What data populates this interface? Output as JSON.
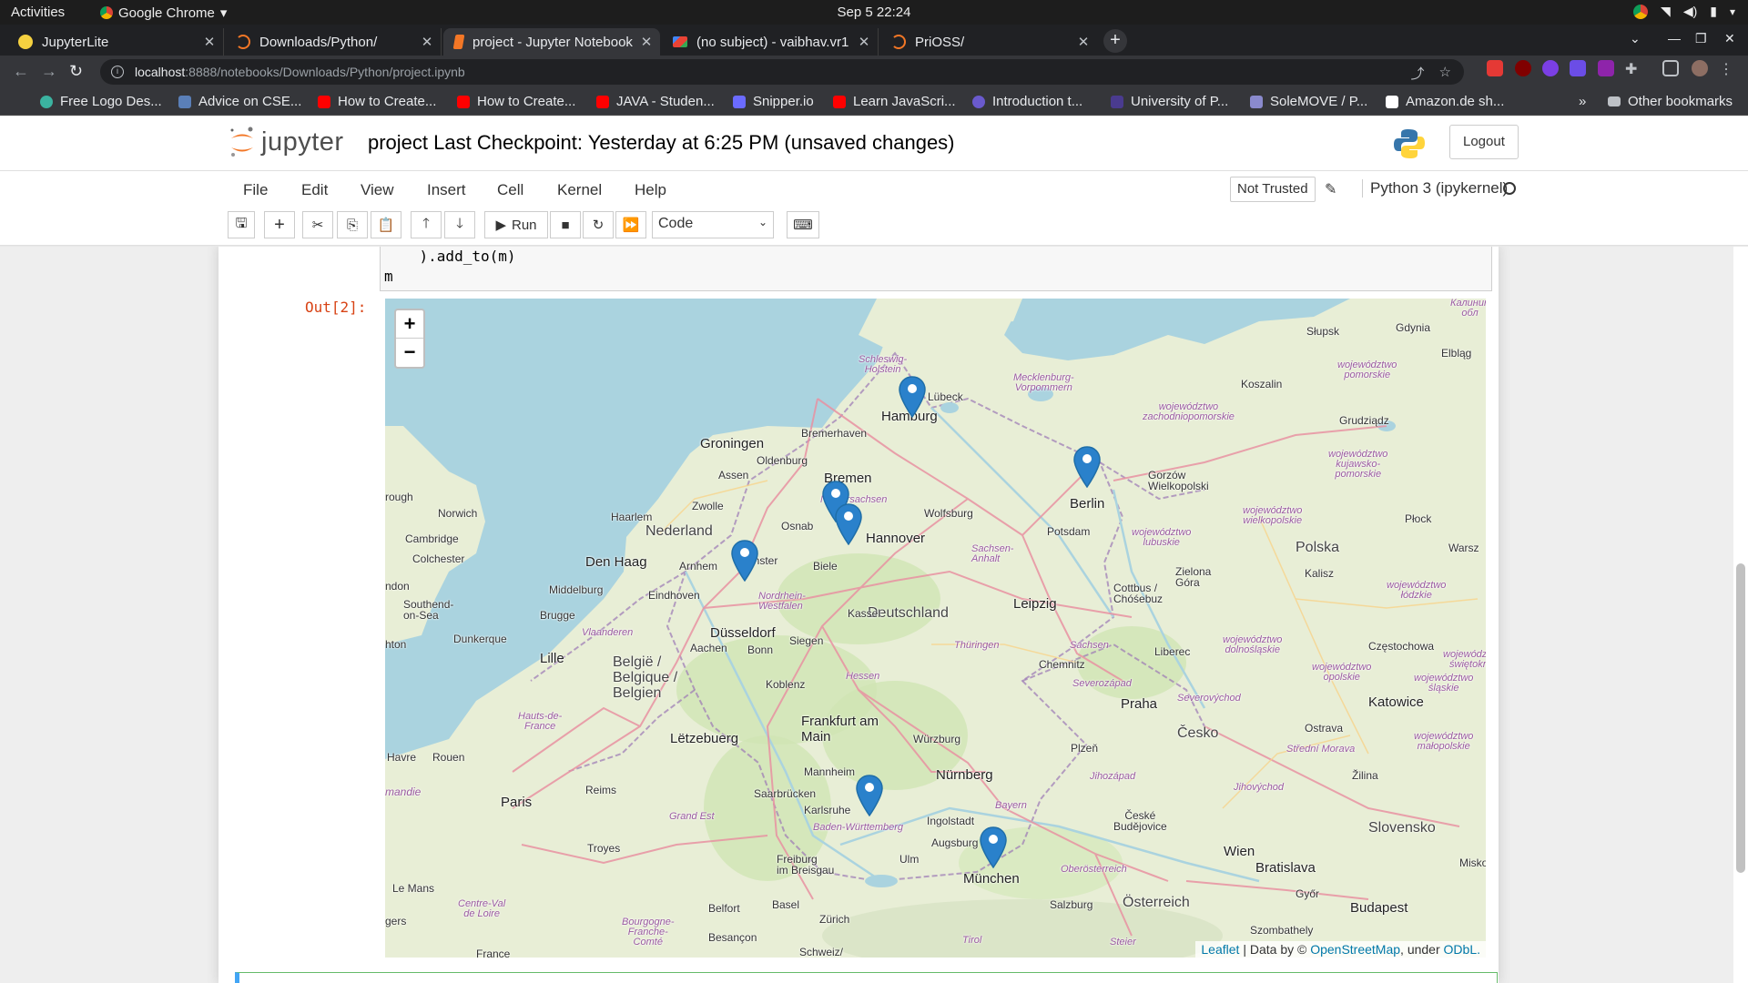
{
  "os": {
    "activities": "Activities",
    "app_name": "Google Chrome",
    "clock": "Sep 5  22:24"
  },
  "tabs": [
    {
      "title": "JupyterLite",
      "active": false
    },
    {
      "title": "Downloads/Python/",
      "active": false
    },
    {
      "title": "project - Jupyter Notebook",
      "active": true
    },
    {
      "title": "(no subject) - vaibhav.vr1",
      "active": false
    },
    {
      "title": "PriOSS/",
      "active": false
    }
  ],
  "address": {
    "host": "localhost",
    "path": ":8888/notebooks/Downloads/Python/project.ipynb"
  },
  "bookmarks": [
    {
      "label": "Free Logo Des...",
      "color": "#3bb3a0"
    },
    {
      "label": "Advice on CSE...",
      "color": "#5a7fb8"
    },
    {
      "label": "How to Create...",
      "color": "#ff0000"
    },
    {
      "label": "How to Create...",
      "color": "#ff0000"
    },
    {
      "label": "JAVA - Studen...",
      "color": "#ff0000"
    },
    {
      "label": "Snipper.io",
      "color": "#6b6bff"
    },
    {
      "label": "Learn JavaScri...",
      "color": "#ff0000"
    },
    {
      "label": "Introduction t...",
      "color": "#6a5acd"
    },
    {
      "label": "University of P...",
      "color": "#4a3b8f"
    },
    {
      "label": "SoleMOVE / P...",
      "color": "#8a8acd"
    },
    {
      "label": "Amazon.de sh...",
      "color": "#ffffff"
    }
  ],
  "other_bookmarks": "Other bookmarks",
  "jupyter": {
    "logo_text": "jupyter",
    "notebook_title": "project Last Checkpoint: Yesterday at 6:25 PM  (unsaved changes)",
    "logout": "Logout",
    "menu": [
      "File",
      "Edit",
      "View",
      "Insert",
      "Cell",
      "Kernel",
      "Help"
    ],
    "not_trusted": "Not Trusted",
    "kernel_name": "Python 3 (ipykernel)",
    "run_label": "Run",
    "cell_type": "Code"
  },
  "cell": {
    "code_lines": [
      "    ).add_to(m)",
      "m"
    ],
    "out_prompt": "Out[2]:"
  },
  "map": {
    "zoom_in": "+",
    "zoom_out": "−",
    "attribution": {
      "leaflet": "Leaflet",
      "data_by": " | Data by © ",
      "osm": "OpenStreetMap",
      "under": ", under ",
      "odbl": "ODbL."
    },
    "marker_cities": [
      "Hamburg",
      "Berlin",
      "Osnabrück",
      "Bielefeld",
      "Düsseldorf",
      "Karlsruhe",
      "München"
    ],
    "place_labels": {
      "hamburg": "Hamburg",
      "berlin": "Berlin",
      "bremen": "Bremen",
      "hannover": "Hannover",
      "groningen": "Groningen",
      "oldenburg": "Oldenburg",
      "bremerhaven": "Bremerhaven",
      "lubeck": "Lübeck",
      "assen": "Assen",
      "zwolle": "Zwolle",
      "nederland": "Nederland",
      "denhaag": "Den Haag",
      "haarlem": "Haarlem",
      "arnhem": "Arnhem",
      "munster": "Münster",
      "osnabruck": "Osnab",
      "biele": "Biele",
      "wolfsburg": "Wolfsburg",
      "potsdam": "Potsdam",
      "deutschland": "Deutschland",
      "kassel": "Kassel",
      "leipzig": "Leipzig",
      "dusseldorf": "Düsseldorf",
      "eindhoven": "Eindhoven",
      "middelburg": "Middelburg",
      "brugge": "Brugge",
      "dunkerque": "Dunkerque",
      "lille": "Lille",
      "aachen": "Aachen",
      "bonn": "Bonn",
      "siegen": "Siegen",
      "koblenz": "Koblenz",
      "belgique": "België /\nBelgique /\nBelgien",
      "frankfurt": "Frankfurt am\nMain",
      "wurzburg": "Würzburg",
      "chemnitz": "Chemnitz",
      "cottbus": "Cottbus /\nChóśebuz",
      "zielona": "Zielona\nGóra",
      "polska": "Polska",
      "praha": "Praha",
      "cesko": "Česko",
      "liberec": "Liberec",
      "plzen": "Plzeň",
      "nurnberg": "Nürnberg",
      "letzebuerg": "Lëtzebuerg",
      "mannheim": "Mannheim",
      "saarbrucken": "Saarbrücken",
      "karlsruhe": "Karlsruhe",
      "ingolstadt": "Ingolstadt",
      "augsburg": "Augsburg",
      "ulm": "Ulm",
      "munchen": "München",
      "freiburg": "Freiburg\nim Breisgau",
      "basel": "Basel",
      "zurich": "Zürich",
      "paris": "Paris",
      "reims": "Reims",
      "rouen": "Rouen",
      "troyes": "Troyes",
      "lemans": "Le Mans",
      "belfort": "Belfort",
      "besancon": "Besançon",
      "salzburg": "Salzburg",
      "wien": "Wien",
      "bratislava": "Bratislava",
      "osterreich": "Österreich",
      "budapest": "Budapest",
      "gyor": "Győr",
      "slovensko": "Slovensko",
      "zilina": "Žilina",
      "ostrava": "Ostrava",
      "katowice": "Katowice",
      "czestochowa": "Częstochowa",
      "kalisz": "Kalisz",
      "plock": "Płock",
      "grudziadz": "Grudziądz",
      "koszalin": "Koszalin",
      "slupsk": "Słupsk",
      "gdynia": "Gdynia",
      "elblag": "Elbląg",
      "gorzow": "Gorzów\nWielkopolski",
      "warsz": "Warsz",
      "norwich": "Norwich",
      "cambridge": "Cambridge",
      "colchester": "Colchester",
      "southend": "Southend-\non-Sea",
      "rough": "rough",
      "ndon": "ndon",
      "hton": "hton",
      "havre": "Havre",
      "mandie": "mandie",
      "gers": "gers",
      "france": "France",
      "schweiz": "Schweiz/",
      "szombathely": "Szombathely",
      "miskol": "Miskol",
      "ceske": "České\nBudějovice"
    },
    "region_labels": {
      "schleswig": "Schleswig-\nHolstein",
      "mecklenburg": "Mecklenburg-\nVorpommern",
      "niedersachsen": "Niedersachsen",
      "sachsenanhalt": "Sachsen-\nAnhalt",
      "nrw": "Nordrhein-\nWestfalen",
      "thuringen": "Thüringen",
      "sachsen": "Sachsen",
      "hessen": "Hessen",
      "bw": "Baden-Württemberg",
      "bayern": "Bayern",
      "vlaanderen": "Vlaanderen",
      "hauts": "Hauts-de-\nFrance",
      "grandest": "Grand Est",
      "bourgogne": "Bourgogne-\nFranche-\nComté",
      "centre": "Centre-Val\nde Loire",
      "wpomorskie": "województwo\npomorskie",
      "wzach": "województwo\nzachodniopomorskie",
      "wkuj": "województwo\nkujawsko-\npomorskie",
      "wwielk": "województwo\nwielkopolskie",
      "wlub": "województwo\nlubuskie",
      "wdoln": "województwo\ndolnośląskie",
      "wopol": "województwo\nopolskie",
      "wlodz": "województwo\nłódzkie",
      "wslask": "województwo\nśląskie",
      "wmalop": "województwo\nmałopolskie",
      "wswiet": "województwo\nświętokrzy",
      "severozapad": "Severozápad",
      "severovychod": "Severovýchod",
      "jihozapad": "Jihozápad",
      "jihovychod": "Jihovýchod",
      "stredni": "Střední Morava",
      "oberosterreich": "Oberösterreich",
      "steier": "Steier",
      "tirol": "Tirol",
      "kalin": "Калинин\nобл"
    }
  },
  "colors": {
    "water": "#aad3df",
    "land": "#e9efd8",
    "marker": "#2a81cb",
    "jupyter_orange": "#f37726",
    "prompt_red": "#d84315"
  }
}
